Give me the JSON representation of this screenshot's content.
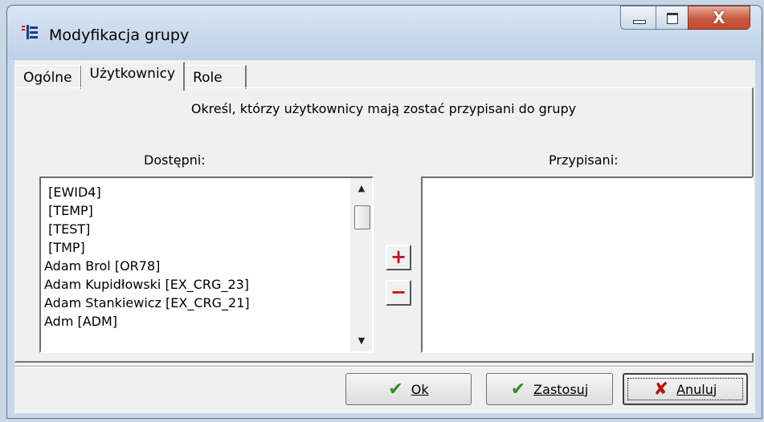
{
  "window": {
    "title": "Modyfikacja grupy",
    "close_glyph": "X"
  },
  "tabs": [
    {
      "label": "Ogólne"
    },
    {
      "label": "Użytkownicy"
    },
    {
      "label": "Role"
    }
  ],
  "page": {
    "description": "Określ, którzy użytkownicy mają zostać przypisani do grupy",
    "available_label": "Dostępni:",
    "assigned_label": "Przypisani:",
    "available_items": [
      " [EWID4]",
      " [TEMP]",
      " [TEST]",
      " [TMP]",
      "Adam Brol [OR78]",
      "Adam Kupidłowski [EX_CRG_23]",
      "Adam Stankiewicz [EX_CRG_21]",
      "Adm [ADM]"
    ],
    "assigned_items": [],
    "add_glyph": "+",
    "remove_glyph": "−"
  },
  "buttons": {
    "ok_label": "Ok",
    "apply_label": "Zastosuj",
    "cancel_label": "Anuluj"
  },
  "colors": {
    "title_bar": "#c7d8ec",
    "dialog_bg": "#f0f0f0",
    "close_button": "#c85a40",
    "add_remove_glyph": "#c0121a",
    "check_green": "#2e8f1f"
  },
  "icons": {
    "app": "app-grid-icon",
    "ok": "checkmark-icon",
    "apply": "double-checkmark-icon",
    "cancel": "red-x-icon"
  }
}
